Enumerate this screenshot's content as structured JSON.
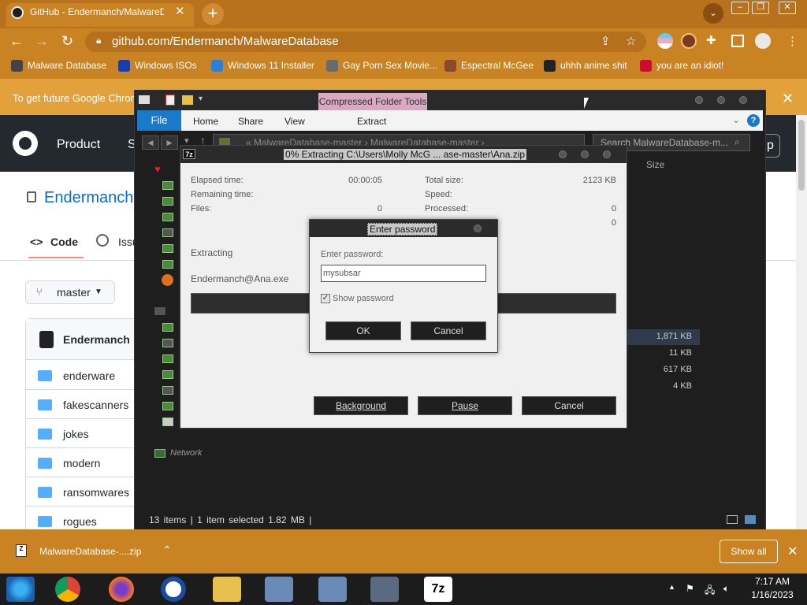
{
  "browser": {
    "tab_title": "GitHub - Endermanch/MalwareDa",
    "tab_close": "✕",
    "new_tab": "+",
    "tab_search": "⌄",
    "url": "github.com/Endermanch/MalwareDatabase",
    "bookmarks": [
      {
        "label": "Malware Database",
        "color": "#444444"
      },
      {
        "label": "Windows ISOs",
        "color": "#1a3ea8"
      },
      {
        "label": "Windows 11 Installer",
        "color": "#2d7fd6"
      },
      {
        "label": "Gay Porn Sex Movie...",
        "color": "#6a6a6a"
      },
      {
        "label": "Espectral McGee",
        "color": "#8a4a2a"
      },
      {
        "label": "uhhh anime shit",
        "color": "#222222"
      },
      {
        "label": "you are an idiot!",
        "color": "#c8102e"
      }
    ],
    "infobar_text": "To get future Google Chrom",
    "infobar_close": "✕"
  },
  "github": {
    "nav_product": "Product",
    "nav_s": "S",
    "nav_up": "up",
    "repo_owner": "Endermanch /",
    "tab_code": "Code",
    "tab_code_icon": "<>",
    "tab_issues": "Issu",
    "branch": "master",
    "author": "Endermanch",
    "files": [
      "enderware",
      "fakescanners",
      "jokes",
      "modern",
      "ransomwares",
      "rogues"
    ]
  },
  "explorer": {
    "contextual_tab": "Compressed Folder Tools",
    "ribbon_tabs": [
      "File",
      "Home",
      "Share",
      "View",
      "Extract"
    ],
    "address": "«  MalwareDatabase-master  ›  MalwareDatabase-master  ›",
    "search_placeholder": "Search MalwareDatabase-m...",
    "size_header": "Size",
    "sizes": [
      "1,871 KB",
      "11 KB",
      "617 KB",
      "4 KB"
    ],
    "nav_network": "Network",
    "status": "13 items  |  1 item selected  1.82 MB  |"
  },
  "zip_dialog": {
    "title": "0% Extracting C:\\Users\\Molly McG ... ase-master\\Ana.zip",
    "icon_label": "7z",
    "elapsed_label": "Elapsed time:",
    "elapsed_value": "00:00:05",
    "remaining_label": "Remaining time:",
    "files_label": "Files:",
    "files_value": "0",
    "total_size_label": "Total size:",
    "total_size_value": "2123 KB",
    "speed_label": "Speed:",
    "processed_label": "Processed:",
    "processed_value": "0",
    "extra_value": "0",
    "extracting_label": "Extracting",
    "current_file": "Endermanch@Ana.exe",
    "progress": 0,
    "btn_background": "Background",
    "btn_pause": "Pause",
    "btn_cancel": "Cancel"
  },
  "password_dialog": {
    "title": "Enter password",
    "label": "Enter password:",
    "value": "mysubsar",
    "show_password_label": "Show password",
    "show_password_checked": true,
    "ok": "OK",
    "cancel": "Cancel"
  },
  "downloads": {
    "file": "MalwareDatabase-....zip",
    "icon_label": "Z",
    "show_all": "Show all",
    "close": "✕"
  },
  "taskbar": {
    "time": "7:17 AM",
    "date": "1/16/2023",
    "apps": [
      "windows-start-icon",
      "chrome-icon",
      "firefox-icon",
      "ie-icon",
      "file-explorer-icon",
      "installer-icon",
      "installer-icon",
      "documents-icon",
      "7zip-icon"
    ],
    "label_7z": "7z"
  },
  "colors": {
    "chrome_theme": "#c98322",
    "github_dark": "#24292f",
    "github_link": "#0969da",
    "explorer_file_tab": "#1979ca",
    "compressed_tab": "#d8a8c4"
  }
}
